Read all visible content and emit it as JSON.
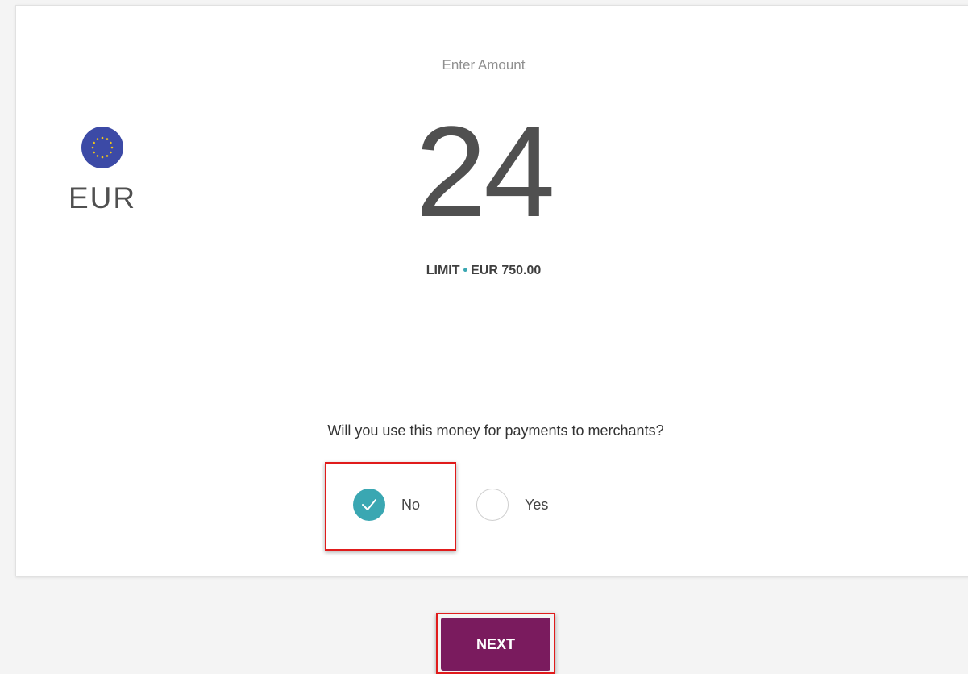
{
  "amount_section": {
    "label": "Enter Amount",
    "amount": "24",
    "currency": {
      "code": "EUR",
      "icon": "eu-flag-icon"
    },
    "limit_label": "LIMIT",
    "limit_separator": "•",
    "limit_value": "EUR 750.00"
  },
  "question": {
    "text": "Will you use this money for payments to merchants?",
    "options": [
      {
        "label": "No",
        "selected": true
      },
      {
        "label": "Yes",
        "selected": false
      }
    ]
  },
  "actions": {
    "next_label": "NEXT"
  },
  "colors": {
    "accent": "#3aa7b2",
    "primary_button": "#7a1b5e",
    "highlight": "#e01b1b",
    "flag_blue": "#3c4aa6"
  }
}
